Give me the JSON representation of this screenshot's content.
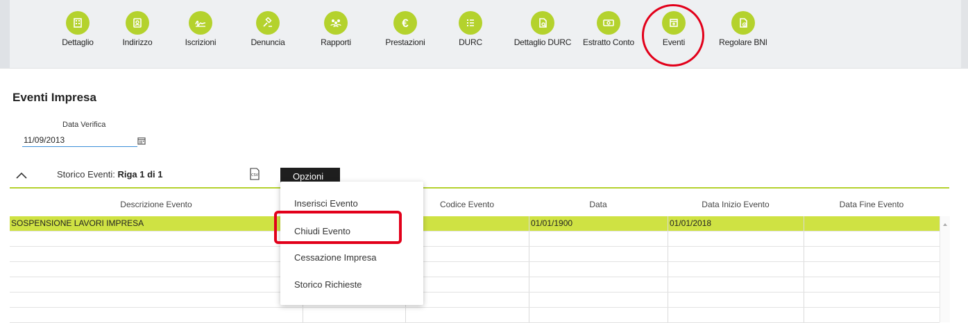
{
  "toolbar": {
    "items": [
      {
        "label": "Dettaglio",
        "icon": "building-icon"
      },
      {
        "label": "Indirizzo",
        "icon": "address-book-icon"
      },
      {
        "label": "Iscrizioni",
        "icon": "signature-icon"
      },
      {
        "label": "Denuncia",
        "icon": "gavel-icon"
      },
      {
        "label": "Rapporti",
        "icon": "people-group-icon"
      },
      {
        "label": "Prestazioni",
        "icon": "euro-icon"
      },
      {
        "label": "DURC",
        "icon": "list-icon"
      },
      {
        "label": "Dettaglio DURC",
        "icon": "document-search-icon"
      },
      {
        "label": "Estratto Conto",
        "icon": "banknote-icon"
      },
      {
        "label": "Eventi",
        "icon": "calendar-add-icon"
      },
      {
        "label": "Regolare BNI",
        "icon": "document-check-icon"
      }
    ],
    "accent_color": "#b4d22d"
  },
  "page": {
    "title": "Eventi Impresa"
  },
  "filter": {
    "date_label": "Data Verifica",
    "date_value": "11/09/2013"
  },
  "storico": {
    "label": "Storico Eventi:",
    "rows_info": "Riga 1 di 1",
    "options_label": "Opzioni"
  },
  "table": {
    "columns": [
      "Descrizione Evento",
      "Codice Evento",
      "Data",
      "Data Inizio Evento",
      "Data Fine Evento"
    ],
    "rows": [
      {
        "descrizione": "SOSPENSIONE LAVORI IMPRESA",
        "codice": "",
        "data": "01/01/1900",
        "data_inizio": "01/01/2018",
        "data_fine": ""
      }
    ],
    "selected_color": "#cfe243"
  },
  "menu": {
    "items": [
      "Inserisci Evento",
      "Chiudi Evento",
      "Cessazione Impresa",
      "Storico Richieste"
    ]
  },
  "highlight_color": "#e2001a"
}
